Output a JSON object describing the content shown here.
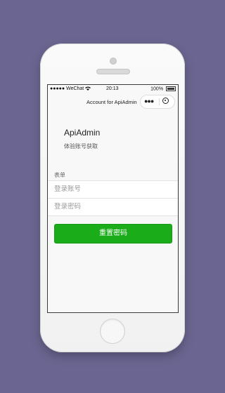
{
  "statusbar": {
    "carrier": "●●●●● WeChat",
    "time": "20:13",
    "battery": "100%"
  },
  "navbar": {
    "title": "Account for ApiAdmin"
  },
  "header": {
    "app_name": "ApiAdmin",
    "description": "体验账号获取"
  },
  "form": {
    "label": "表单",
    "account_placeholder": "登录账号",
    "password_placeholder": "登录密码",
    "submit_label": "重置密码"
  },
  "colors": {
    "background": "#6b6691",
    "primary_button": "#1aad19"
  },
  "icons": {
    "capsule_more": "more-dots-icon",
    "capsule_close": "target-icon",
    "wifi": "wifi-icon",
    "battery": "battery-icon"
  }
}
